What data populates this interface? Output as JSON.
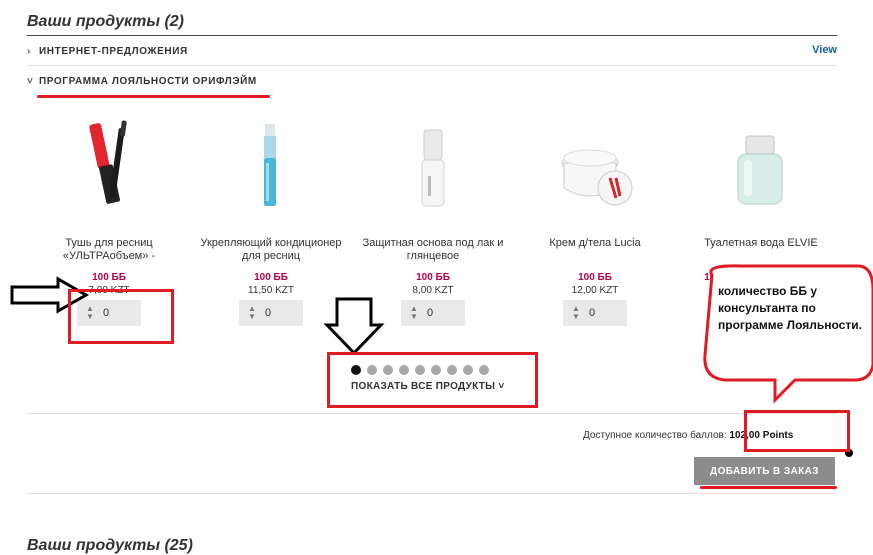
{
  "sections": {
    "top_title": "Ваши продукты (2)",
    "bottom_title": "Ваши продукты (25)"
  },
  "accordion": {
    "internet_offers": "ИНТЕРНЕТ-ПРЕДЛОЖЕНИЯ",
    "view_link": "View",
    "loyalty": "ПРОГРАММА ЛОЯЛЬНОСТИ ОРИФЛЭЙМ"
  },
  "products": [
    {
      "name": "Тушь для ресниц «УЛЬТРАобъем» -",
      "points": "100 ББ",
      "price": "7,00 KZT",
      "qty": "0"
    },
    {
      "name": "Укрепляющий кондиционер для ресниц",
      "points": "100 ББ",
      "price": "11,50 KZT",
      "qty": "0"
    },
    {
      "name": "Защитная основа под лак и глянцевое",
      "points": "100 ББ",
      "price": "8,00 KZT",
      "qty": "0"
    },
    {
      "name": "Крем д/тела Lucia",
      "points": "100 ББ",
      "price": "12,00 KZT",
      "qty": "0"
    },
    {
      "name": "Туалетная вода ELVIE",
      "points": "100 points + 995,00 KZT",
      "price": "",
      "qty": ""
    }
  ],
  "pagination": {
    "total": 9,
    "active": 1
  },
  "show_all": "ПОКАЗАТЬ ВСЕ ПРОДУКТЫ",
  "available_points": {
    "label": "Доступное количество баллов:",
    "value": "102,00 Points"
  },
  "add_button": "ДОБАВИТЬ В ЗАКАЗ",
  "annotation": "количество ББ у консультанта по программе Лояльности.",
  "colors": {
    "accent_red": "#e01b22",
    "points_magenta": "#b5004a",
    "link_blue": "#1a5fa8",
    "button_gray": "#8c8c8c"
  }
}
